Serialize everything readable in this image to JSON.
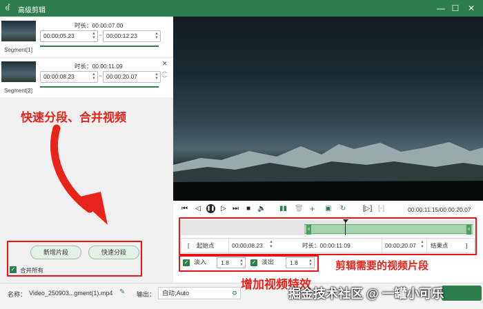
{
  "window": {
    "title": "高级剪辑"
  },
  "segments": [
    {
      "label": "Segment[1]",
      "duration": "时长：00:00:07.00",
      "start": "00:00:05.23",
      "end": "00:00:12.23"
    },
    {
      "label": "Segment[2]",
      "duration": "时长：00:00:11.09",
      "start": "00:00:08.23",
      "end": "00:00:20.07"
    }
  ],
  "annotations": {
    "left": "快速分段、合并视频",
    "right": "剪辑需要的视频片段",
    "effects": "增加视频特效"
  },
  "buttons": {
    "add_segment": "新增片段",
    "quick_split": "快速分段",
    "merge_all": "合并所有"
  },
  "player": {
    "time_readout": "00:00:11.15/00:00:20.07"
  },
  "clip": {
    "start_label": "起始点",
    "start": "00:00:08.23",
    "duration": "时长：00:00:11.09",
    "end": "00:00:20.07",
    "end_label": "结束点",
    "bracket_open": "[",
    "bracket_close": "]"
  },
  "effects": {
    "fade_in_label": "淡入",
    "fade_in": "1.8",
    "fade_out_label": "淡出",
    "fade_out": "1.8"
  },
  "footer": {
    "name_label": "名称：",
    "filename": "Video_250903...gment(1).mp4",
    "output_label": "输出：",
    "output": "自动;Auto"
  },
  "watermark": "掘金技术社区 @ 一罐小可乐",
  "colors": {
    "accent": "#2e7d4f",
    "annotation": "#e8231a"
  }
}
